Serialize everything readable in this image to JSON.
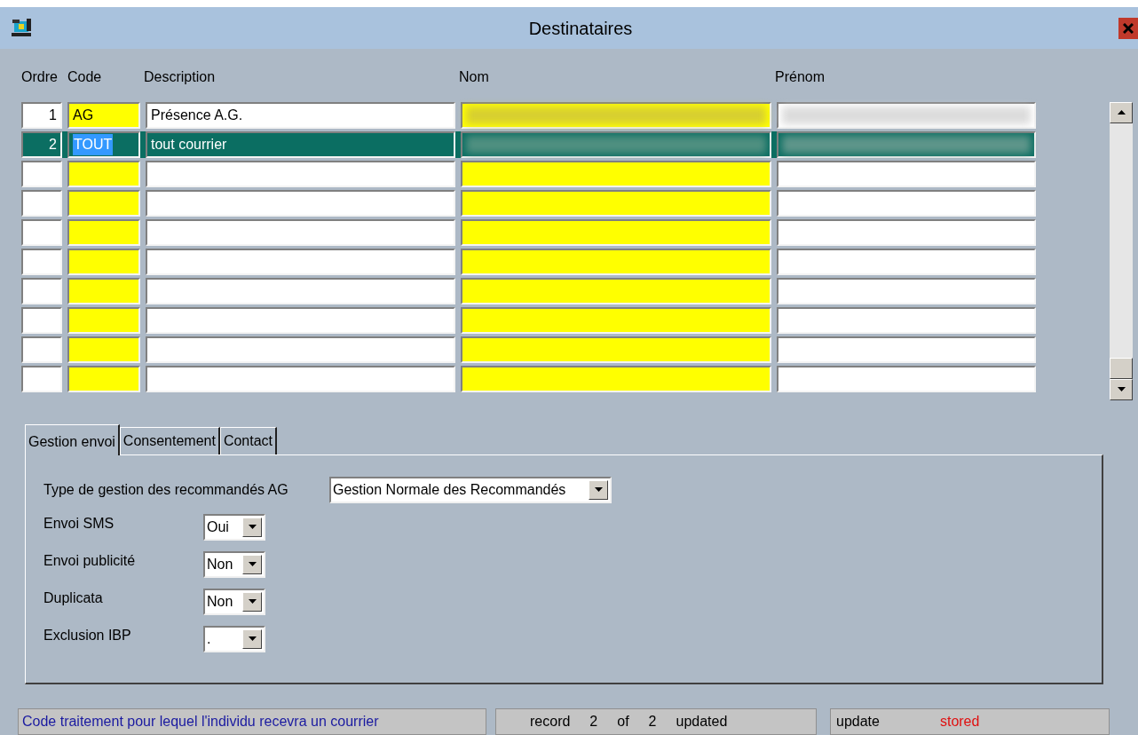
{
  "window": {
    "title": "Destinataires"
  },
  "table": {
    "columns": [
      "Ordre",
      "Code",
      "Description",
      "Nom",
      "Prénom"
    ],
    "rows": [
      {
        "ordre": "1",
        "code": "AG",
        "description": "Présence A.G.",
        "redacted": true,
        "selected": false
      },
      {
        "ordre": "2",
        "code": "TOUT",
        "description": "tout courrier",
        "redacted": true,
        "selected": true
      },
      {
        "selected": false
      },
      {
        "selected": false
      },
      {
        "selected": false
      },
      {
        "selected": false
      },
      {
        "selected": false
      },
      {
        "selected": false
      },
      {
        "selected": false
      },
      {
        "selected": false
      }
    ]
  },
  "tabs": [
    {
      "label": "Gestion envoi",
      "selected": true
    },
    {
      "label": "Consentement",
      "selected": false
    },
    {
      "label": "Contact",
      "selected": false
    }
  ],
  "form": {
    "fields": [
      {
        "label": "Type de gestion des recommandés AG",
        "value": "Gestion Normale des Recommandés",
        "kind": "wide"
      },
      {
        "label": "Envoi SMS",
        "value": "Oui",
        "kind": "short"
      },
      {
        "label": "Envoi publicité",
        "value": "Non",
        "kind": "short"
      },
      {
        "label": "Duplicata",
        "value": "Non",
        "kind": "short"
      },
      {
        "label": "Exclusion IBP",
        "value": ".",
        "kind": "short"
      }
    ]
  },
  "status_bar": {
    "message": "Code traitement pour lequel l'individu recevra un courrier",
    "record": [
      "record",
      "2",
      "of",
      "2",
      "updated"
    ],
    "state": {
      "label": "update",
      "value": "stored"
    }
  }
}
